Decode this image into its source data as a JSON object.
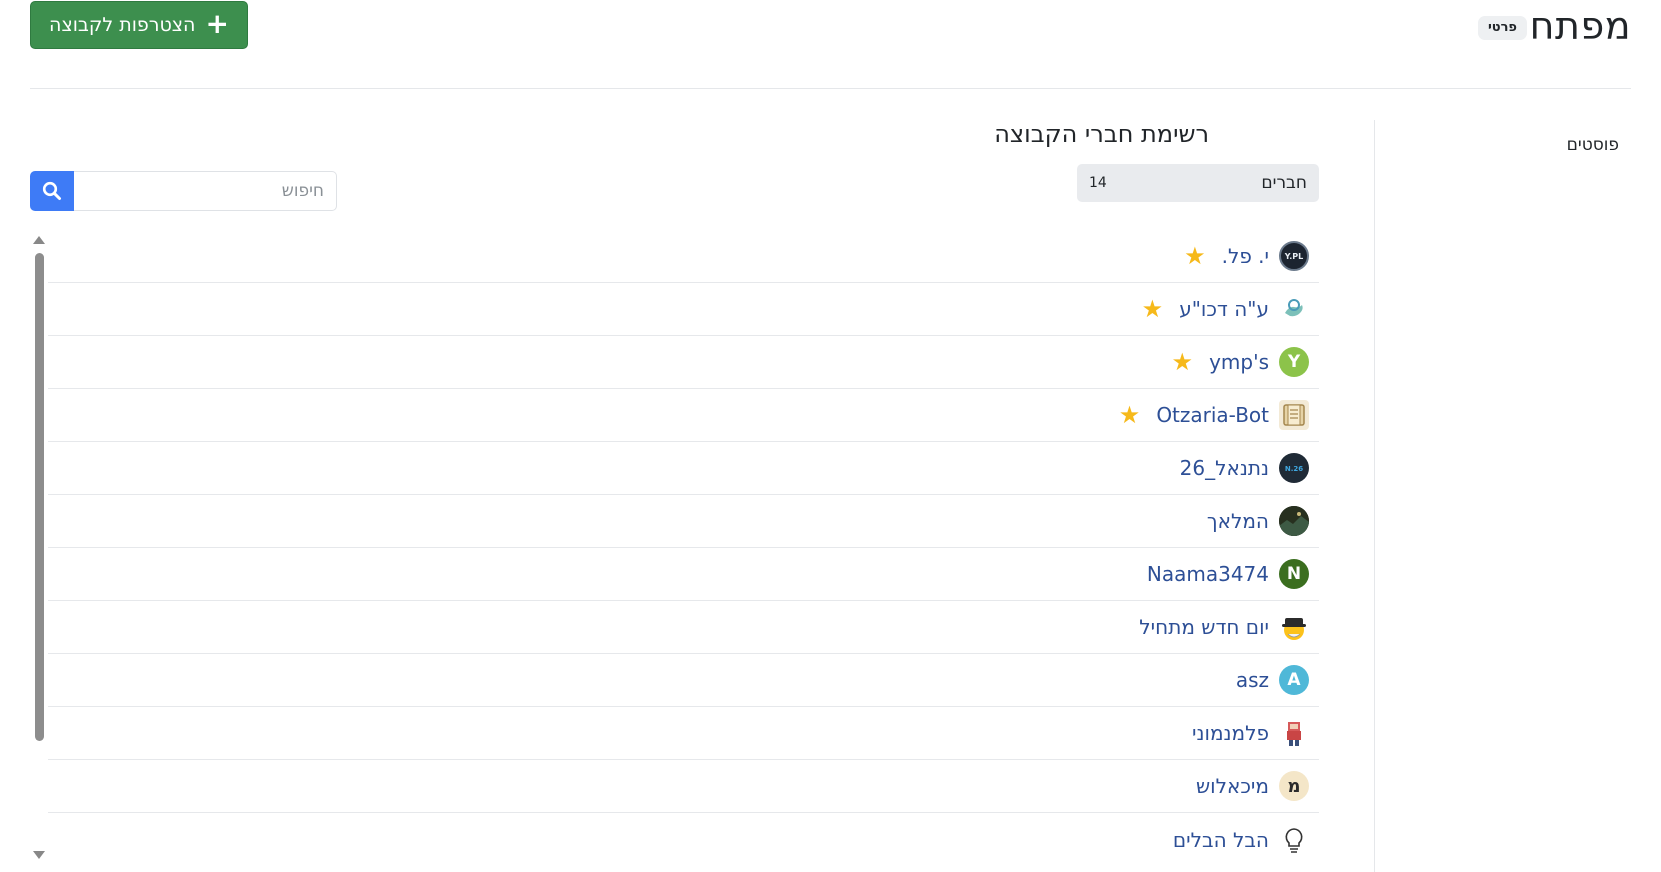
{
  "header": {
    "title": "מפתח",
    "badge": "פרטי",
    "join_button": "הצטרפות לקבוצה",
    "join_icon": "plus-icon"
  },
  "sidebar": {
    "items": [
      {
        "label": "פוסטים"
      },
      {
        "label": "חברים",
        "count": "14"
      }
    ]
  },
  "main": {
    "title": "רשימת חברי הקבוצה",
    "search_placeholder": "חיפוש",
    "search_icon": "search-icon"
  },
  "colors": {
    "join_button": "#3d8f4e",
    "search_button": "#3e7bf6",
    "link": "#2d4f96",
    "star": "#f6b91a"
  },
  "members": [
    {
      "name": "י. פל.",
      "owner": true
    },
    {
      "name": "ע\"ה דכו\"ע",
      "owner": true
    },
    {
      "name": "ymp's",
      "owner": true,
      "initial": "Y",
      "avatar_color": "#8cc34a"
    },
    {
      "name": "Otzaria-Bot",
      "owner": true
    },
    {
      "name": "נתנאל_26",
      "owner": false
    },
    {
      "name": "המלאך",
      "owner": false
    },
    {
      "name": "Naama3474",
      "owner": false,
      "initial": "N",
      "avatar_color": "#3b6e1f"
    },
    {
      "name": "יום חדש מתחיל",
      "owner": false
    },
    {
      "name": "asz",
      "owner": false,
      "initial": "A",
      "avatar_color": "#4fb8d8"
    },
    {
      "name": "פלמנמוני",
      "owner": false
    },
    {
      "name": "מיכאלוש",
      "owner": false
    },
    {
      "name": "הבל הבלים",
      "owner": false
    }
  ]
}
